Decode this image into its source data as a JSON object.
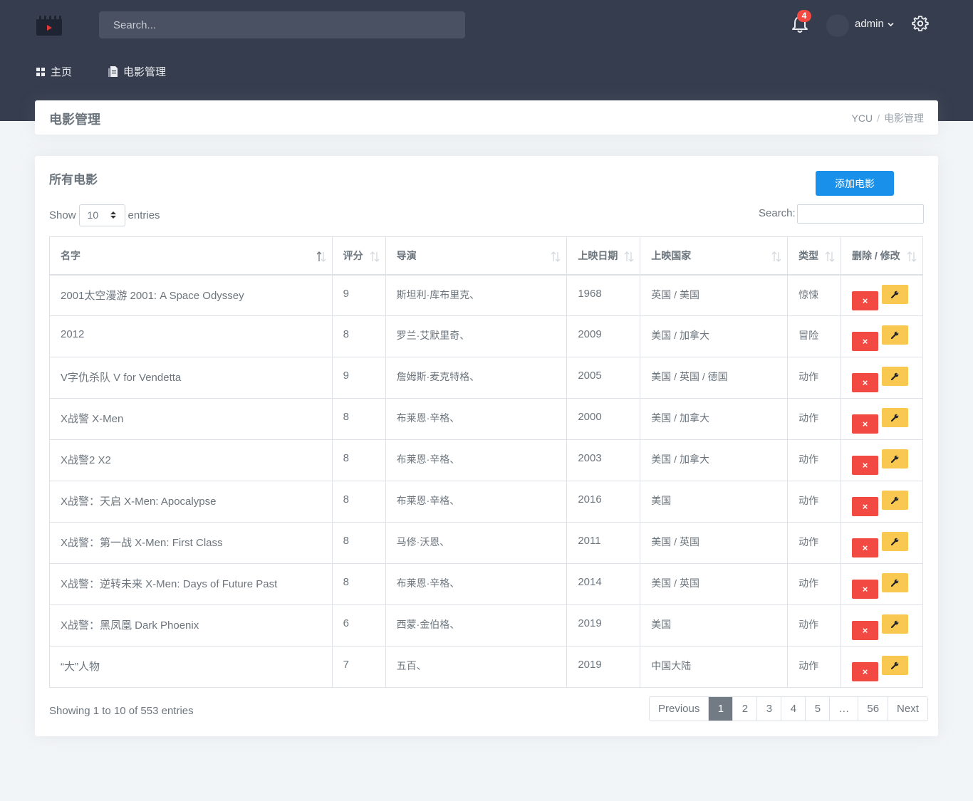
{
  "header": {
    "search_placeholder": "Search...",
    "notification_count": "4",
    "user_name": "admin",
    "nav": [
      {
        "label": "主页",
        "icon": "dashboard-icon"
      },
      {
        "label": "电影管理",
        "icon": "document-icon"
      }
    ]
  },
  "page": {
    "title": "电影管理",
    "breadcrumb": [
      "YCU",
      "电影管理"
    ]
  },
  "content": {
    "section_title": "所有电影",
    "add_button": "添加电影",
    "show_label": "Show",
    "page_size": "10",
    "entries_label": "entries",
    "search_label": "Search:",
    "columns": [
      "名字",
      "评分",
      "导演",
      "上映日期",
      "上映国家",
      "类型",
      "删除 / 修改"
    ],
    "rows": [
      {
        "name": "2001太空漫游 2001: A Space Odyssey",
        "rating": "9",
        "director": "斯坦利·库布里克、",
        "year": "1968",
        "country": "英国 / 美国",
        "genre": "惊悚"
      },
      {
        "name": "2012",
        "rating": "8",
        "director": "罗兰·艾默里奇、",
        "year": "2009",
        "country": "美国 / 加拿大",
        "genre": "冒险"
      },
      {
        "name": "V字仇杀队 V for Vendetta",
        "rating": "9",
        "director": "詹姆斯·麦克特格、",
        "year": "2005",
        "country": "美国 / 英国 / 德国",
        "genre": "动作"
      },
      {
        "name": "X战警 X-Men",
        "rating": "8",
        "director": "布莱恩·辛格、",
        "year": "2000",
        "country": "美国 / 加拿大",
        "genre": "动作"
      },
      {
        "name": "X战警2 X2",
        "rating": "8",
        "director": "布莱恩·辛格、",
        "year": "2003",
        "country": "美国 / 加拿大",
        "genre": "动作"
      },
      {
        "name": "X战警：天启 X-Men: Apocalypse",
        "rating": "8",
        "director": "布莱恩·辛格、",
        "year": "2016",
        "country": "美国",
        "genre": "动作"
      },
      {
        "name": "X战警：第一战 X-Men: First Class",
        "rating": "8",
        "director": "马修·沃恩、",
        "year": "2011",
        "country": "美国 / 英国",
        "genre": "动作"
      },
      {
        "name": "X战警：逆转未来 X-Men: Days of Future Past",
        "rating": "8",
        "director": "布莱恩·辛格、",
        "year": "2014",
        "country": "美国 / 英国",
        "genre": "动作"
      },
      {
        "name": "X战警：黑凤凰 Dark Phoenix",
        "rating": "6",
        "director": "西蒙·金伯格、",
        "year": "2019",
        "country": "美国",
        "genre": "动作"
      },
      {
        "name": "“大”人物",
        "rating": "7",
        "director": "五百、",
        "year": "2019",
        "country": "中国大陆",
        "genre": "动作"
      }
    ],
    "delete_label": "×",
    "showing_text": "Showing 1 to 10 of 553 entries",
    "pagination": [
      "Previous",
      "1",
      "2",
      "3",
      "4",
      "5",
      "…",
      "56",
      "Next"
    ],
    "active_page": "1"
  }
}
